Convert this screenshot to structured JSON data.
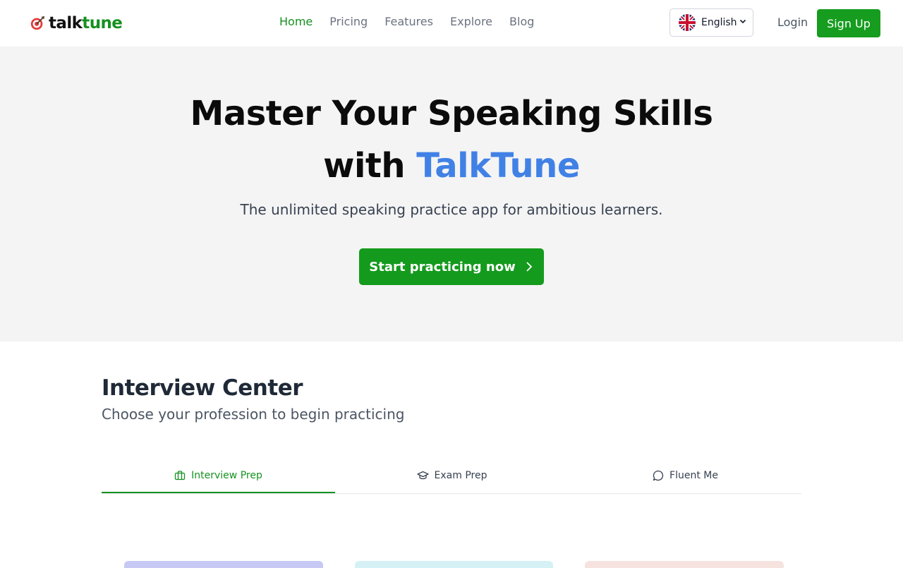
{
  "navbar": {
    "logo": {
      "part1": "talk",
      "part2": "tune"
    },
    "links": [
      {
        "label": "Home",
        "active": true
      },
      {
        "label": "Pricing"
      },
      {
        "label": "Features"
      },
      {
        "label": "Explore"
      },
      {
        "label": "Blog"
      }
    ],
    "language": {
      "label": "English",
      "flag_icon": "uk-flag-icon"
    },
    "login_label": "Login",
    "signup_label": "Sign Up"
  },
  "hero": {
    "title_line1": "Master Your Speaking Skills",
    "title_line2_prefix": "with ",
    "title_line2_brand": "TalkTune",
    "subtitle": "The unlimited speaking practice app for ambitious learners.",
    "cta_label": "Start practicing now"
  },
  "section": {
    "title": "Interview Center",
    "subtitle": "Choose your profession to begin practicing"
  },
  "tabs": [
    {
      "label": "Interview Prep",
      "icon": "briefcase-icon",
      "active": true
    },
    {
      "label": "Exam Prep",
      "icon": "graduation-cap-icon"
    },
    {
      "label": "Fluent Me",
      "icon": "chat-bubble-icon"
    }
  ],
  "colors": {
    "brand_green": "#15911f",
    "brand_blue": "#4181e6",
    "hero_bg": "#f4f4f4"
  }
}
